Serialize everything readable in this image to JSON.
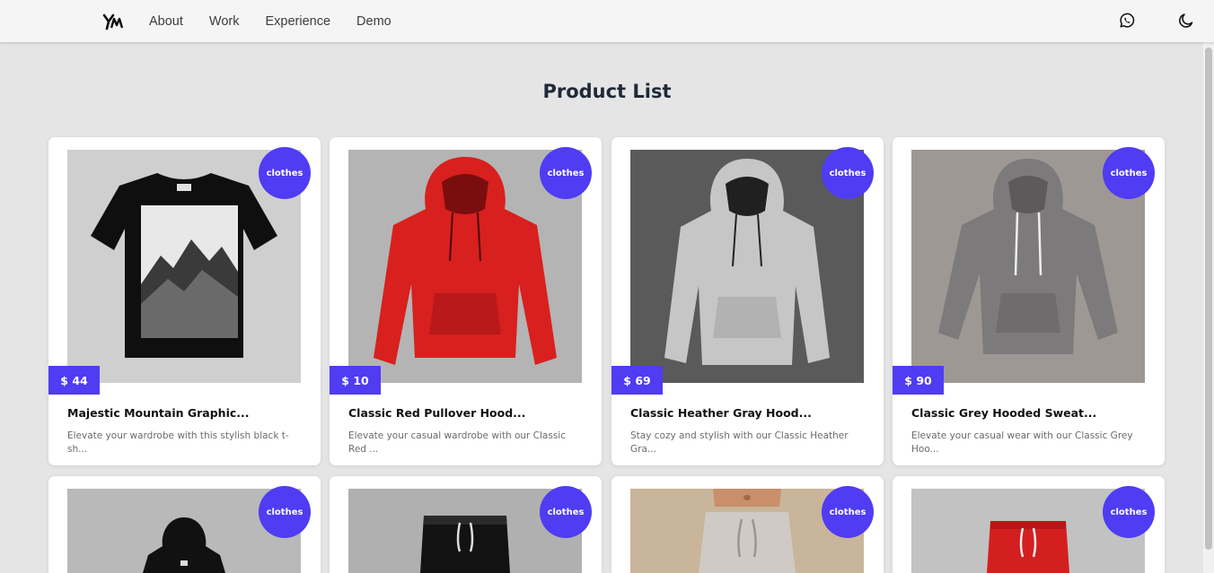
{
  "nav": {
    "links": [
      "About",
      "Work",
      "Experience",
      "Demo"
    ],
    "icons": [
      "ym-logo",
      "whatsapp-icon",
      "moon-icon"
    ]
  },
  "page": {
    "title": "Product List"
  },
  "colors": {
    "accent": "#4f3cf3",
    "background": "#e5e5e5",
    "navbar": "#f5f5f5"
  },
  "products": [
    {
      "category": "clothes",
      "price": "$ 44",
      "title": "Majestic Mountain Graphic...",
      "description": "Elevate your wardrobe with this stylish black t-sh..."
    },
    {
      "category": "clothes",
      "price": "$ 10",
      "title": "Classic Red Pullover Hood...",
      "description": "Elevate your casual wardrobe with our Classic Red ..."
    },
    {
      "category": "clothes",
      "price": "$ 69",
      "title": "Classic Heather Gray Hood...",
      "description": "Stay cozy and stylish with our Classic Heather Gra..."
    },
    {
      "category": "clothes",
      "price": "$ 90",
      "title": "Classic Grey Hooded Sweat...",
      "description": "Elevate your casual wear with our Classic Grey Hoo..."
    },
    {
      "category": "clothes"
    },
    {
      "category": "clothes"
    },
    {
      "category": "clothes"
    },
    {
      "category": "clothes"
    }
  ]
}
